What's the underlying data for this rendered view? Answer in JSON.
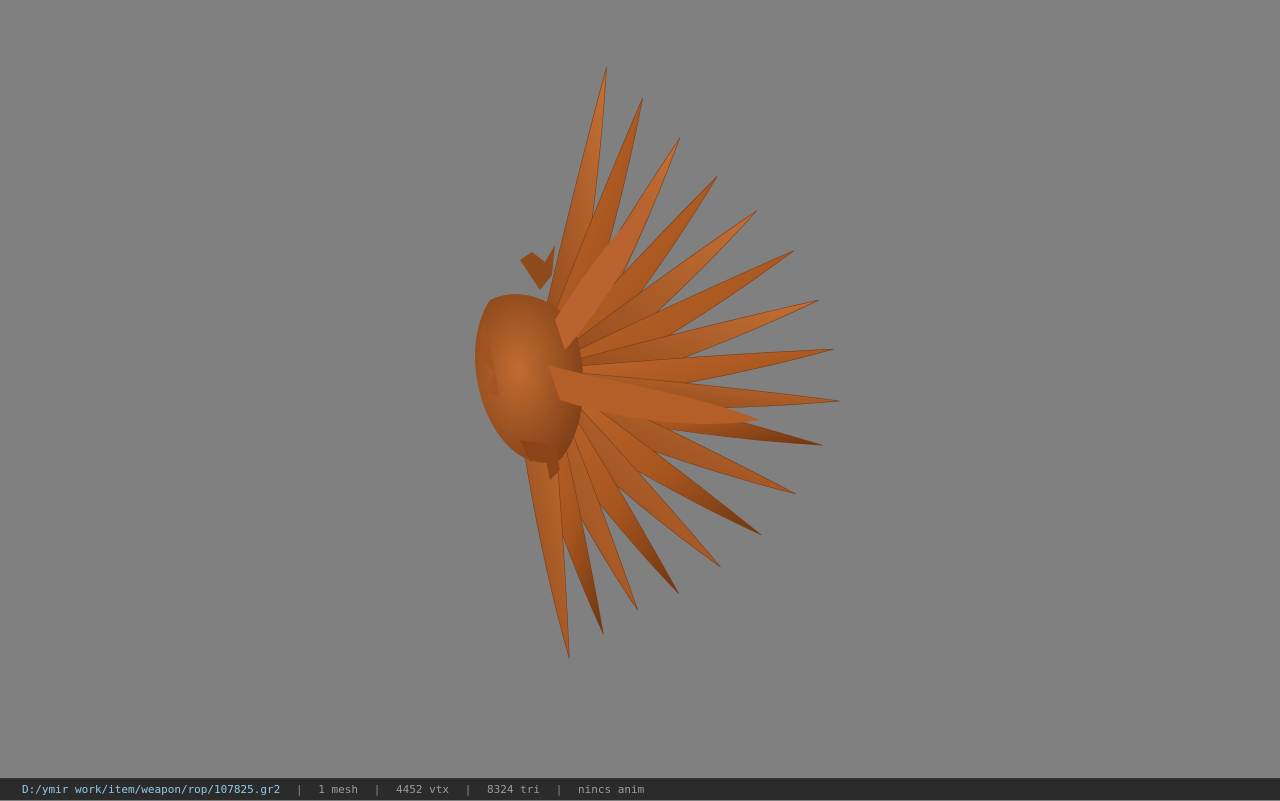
{
  "viewer": {
    "background_color": "#808080",
    "model_color": "#b9622a",
    "model_shadow_color": "#6e3512",
    "model_icon": "wing-model"
  },
  "statusbar": {
    "path": "D:/ymir work/item/weapon/rop/107825.gr2",
    "separator": "|",
    "mesh_count": "1 mesh",
    "vertex_count": "4452 vtx",
    "triangle_count": "8324 tri",
    "anim_status": "nincs anim"
  }
}
